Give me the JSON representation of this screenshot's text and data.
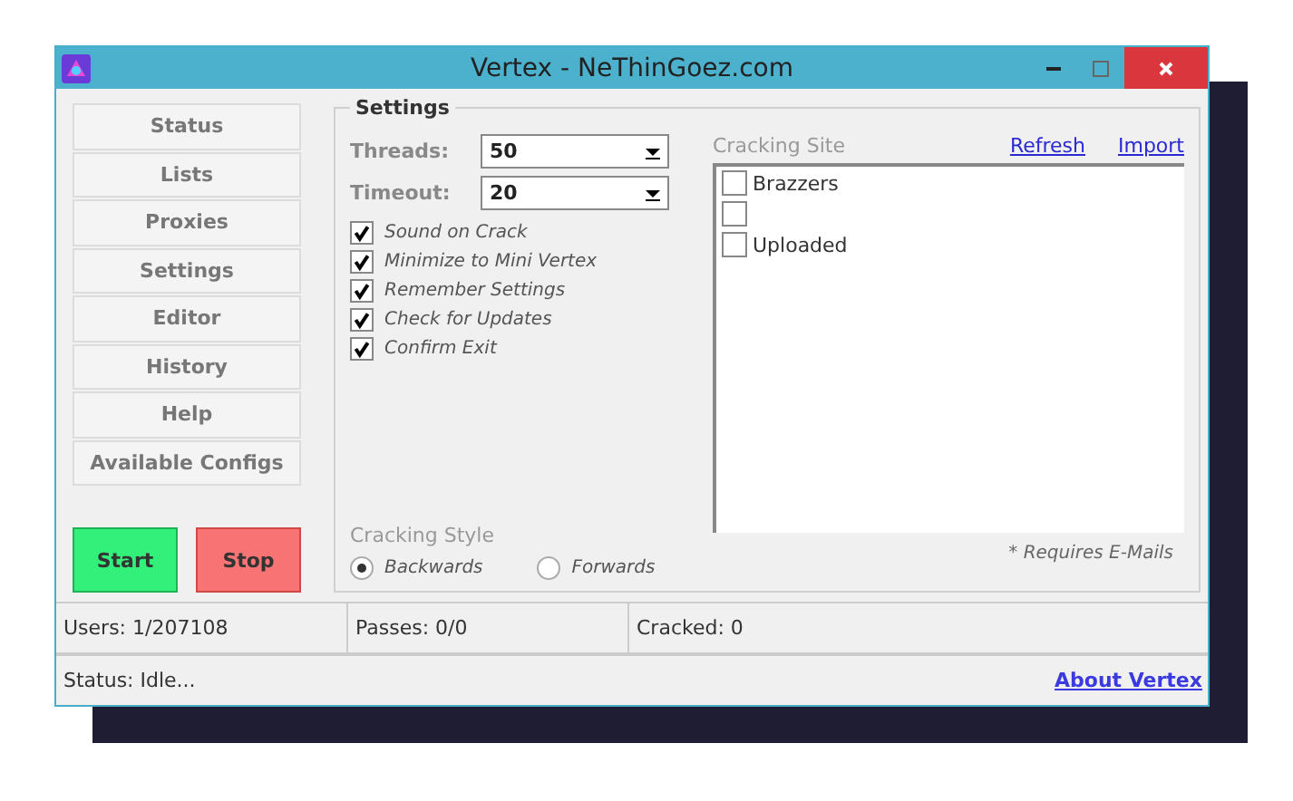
{
  "window": {
    "title": "Vertex - NeThinGoez.com"
  },
  "nav_items": [
    {
      "label": "Status"
    },
    {
      "label": "Lists"
    },
    {
      "label": "Proxies"
    },
    {
      "label": "Settings"
    },
    {
      "label": "Editor"
    },
    {
      "label": "History"
    },
    {
      "label": "Help"
    },
    {
      "label": "Available Configs"
    }
  ],
  "actions": [
    {
      "label": "Start",
      "kind": "start"
    },
    {
      "label": "Stop",
      "kind": "stop"
    }
  ],
  "settings": {
    "title": "Settings",
    "fields": [
      {
        "label": "Threads:",
        "value": "50"
      },
      {
        "label": "Timeout:",
        "value": "20"
      }
    ],
    "options": [
      {
        "label": "Sound on Crack",
        "checked": true
      },
      {
        "label": "Minimize to Mini Vertex",
        "checked": true
      },
      {
        "label": "Remember Settings",
        "checked": true
      },
      {
        "label": "Check for Updates",
        "checked": true
      },
      {
        "label": "Confirm Exit",
        "checked": true
      }
    ],
    "cracking_style": {
      "label": "Cracking Style",
      "options": [
        {
          "label": "Backwards",
          "selected": true
        },
        {
          "label": "Forwards",
          "selected": false
        }
      ]
    },
    "cracking_site": {
      "label": "Cracking Site",
      "links": [
        "Refresh",
        "Import"
      ],
      "sites": [
        {
          "label": "Brazzers",
          "checked": false
        },
        {
          "checked": false
        },
        {
          "label": "Uploaded",
          "checked": false
        }
      ],
      "note": "* Requires E-Mails"
    }
  },
  "status_bar": {
    "panels": [
      "Users: 1/207108",
      "Passes: 0/0",
      "Cracked: 0"
    ],
    "status": "Status: Idle...",
    "about_link": "About Vertex"
  }
}
